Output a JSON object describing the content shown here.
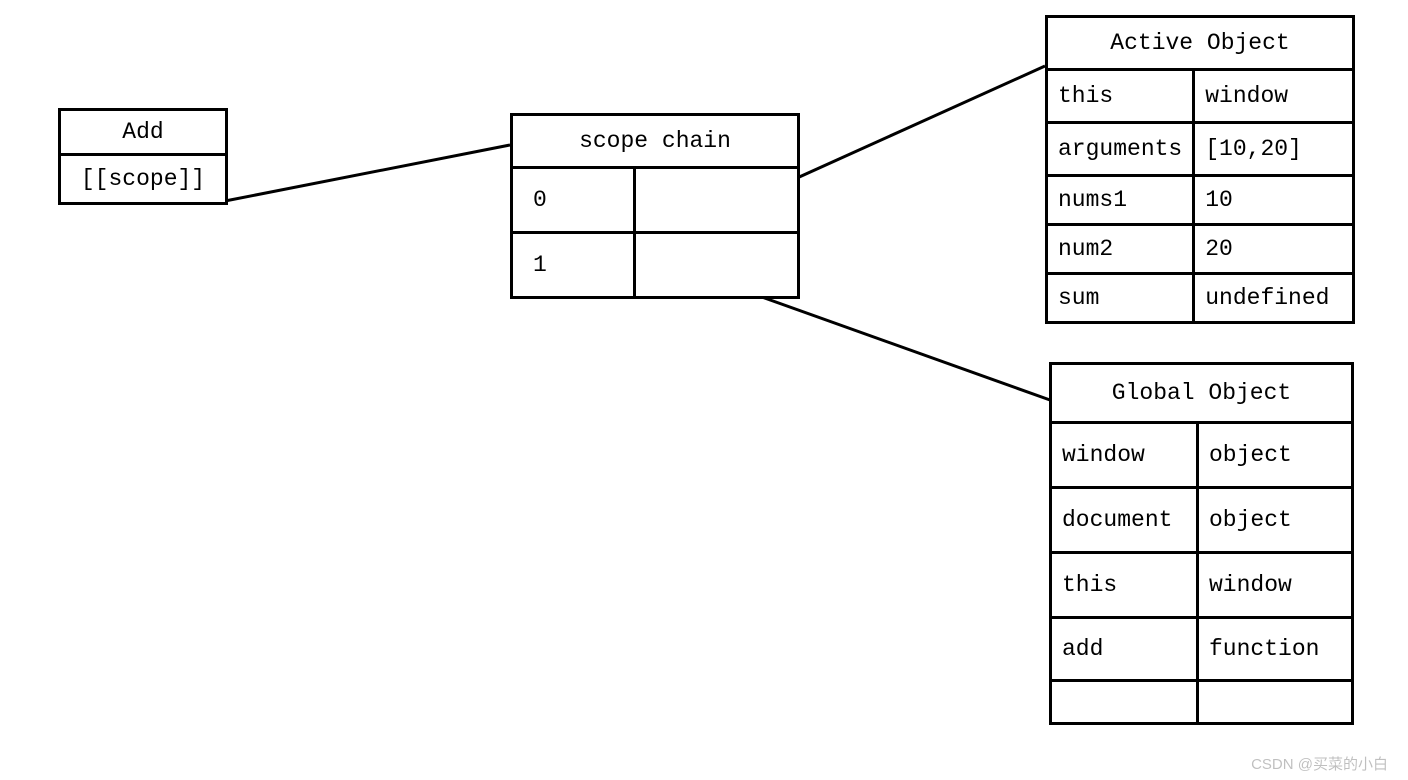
{
  "addBox": {
    "title": "Add",
    "row": "[[scope]]"
  },
  "scopeChain": {
    "title": "scope chain",
    "rows": [
      "0",
      "1"
    ]
  },
  "activeObject": {
    "title": "Active Object",
    "rows": [
      {
        "k": "this",
        "v": "window"
      },
      {
        "k": "arguments",
        "v": "[10,20]"
      },
      {
        "k": "nums1",
        "v": "10"
      },
      {
        "k": "num2",
        "v": "20"
      },
      {
        "k": "sum",
        "v": "undefined"
      }
    ]
  },
  "globalObject": {
    "title": "Global Object",
    "rows": [
      {
        "k": "window",
        "v": "object"
      },
      {
        "k": "document",
        "v": "object"
      },
      {
        "k": "this",
        "v": "window"
      },
      {
        "k": "add",
        "v": "function"
      },
      {
        "k": "",
        "v": ""
      }
    ]
  },
  "watermark": "CSDN @买菜的小白"
}
